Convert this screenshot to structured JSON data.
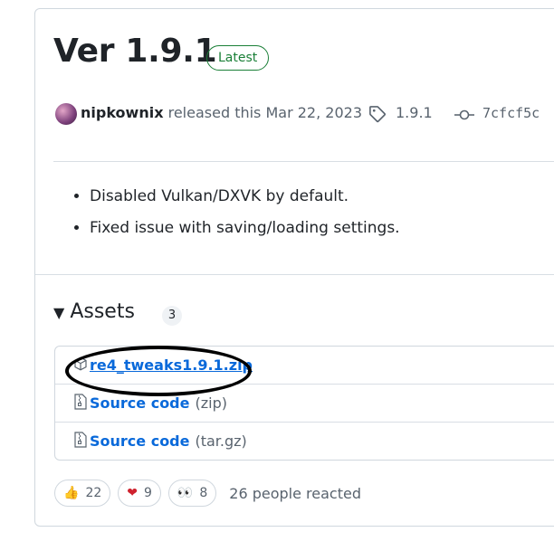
{
  "release": {
    "title": "Ver 1.9.1",
    "badge": "Latest",
    "author": "nipkownix",
    "released_text": "released this Mar 22, 2023",
    "tag": "1.9.1",
    "commit": "7cfcf5c",
    "notes": [
      "Disabled Vulkan/DXVK by default.",
      "Fixed issue with saving/loading settings."
    ]
  },
  "assets": {
    "heading": "Assets",
    "count": "3",
    "items": [
      {
        "name": "re4_tweaks1.9.1.zip",
        "suffix": "",
        "icon": "package-icon"
      },
      {
        "name": "Source code",
        "suffix": "(zip)",
        "icon": "file-zip-icon"
      },
      {
        "name": "Source code",
        "suffix": "(tar.gz)",
        "icon": "file-zip-icon"
      }
    ]
  },
  "reactions": {
    "items": [
      {
        "emoji": "👍",
        "count": "22",
        "icon": "thumbs-up-icon"
      },
      {
        "emoji": "❤",
        "count": "9",
        "icon": "heart-icon"
      },
      {
        "emoji": "👀",
        "count": "8",
        "icon": "eyes-icon"
      }
    ],
    "summary": "26 people reacted"
  },
  "colors": {
    "accent_link": "#0969da",
    "latest_green": "#1a7f37",
    "muted": "#59636e",
    "border": "#d0d7de"
  }
}
